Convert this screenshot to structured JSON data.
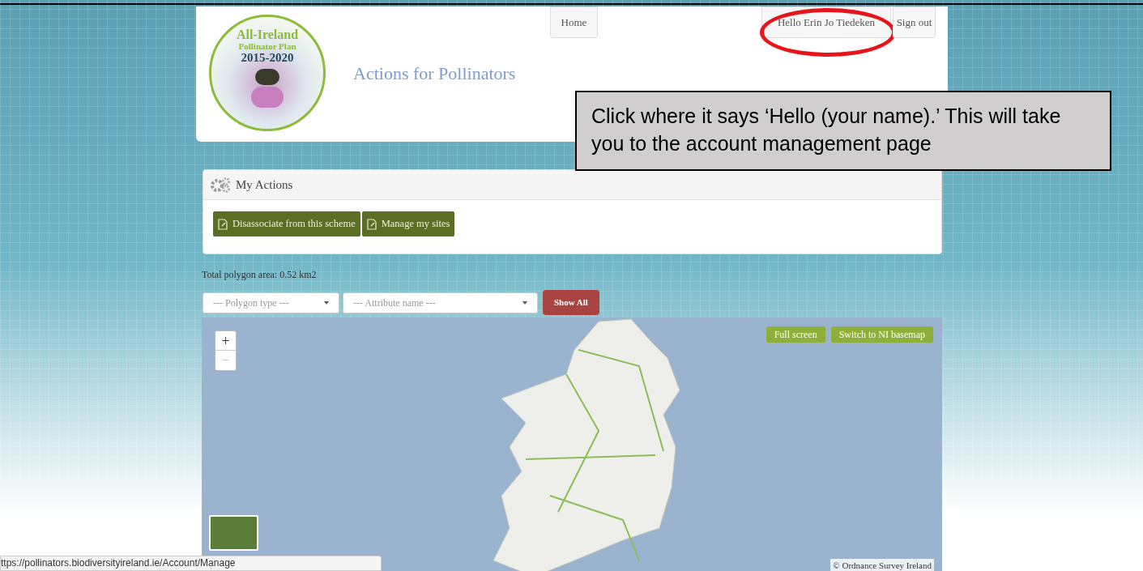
{
  "logo": {
    "line_1": "All-Ireland",
    "line_2": "Pollinator Plan",
    "line_3": "2015-2020"
  },
  "site_title": "Actions for Pollinators",
  "nav": [
    {
      "label": "Home"
    },
    {
      "label": "Hello Erin Jo Tiedeken",
      "highlighted": true
    },
    {
      "label": "Sign out"
    }
  ],
  "callout": {
    "text": "Click where it says ‘Hello (your name).’ This will take you to the account management page"
  },
  "actions_panel": {
    "title": "My Actions",
    "buttons": [
      "Disassociate from this scheme",
      "Manage my sites"
    ]
  },
  "total_area": "Total polygon area: 0.52 km2",
  "filters": [
    {
      "placeholder": "--- Polygon type ---"
    },
    {
      "placeholder": "--- Attribute name ---"
    }
  ],
  "show_all_button": "Show All",
  "map": {
    "zoom_in": "+",
    "zoom_out": "−",
    "buttons": [
      "Full screen",
      "Switch to NI basemap"
    ],
    "attribution": "© Ordnance Survey Ireland"
  },
  "status_bar": "ttps://pollinators.biodiversityireland.ie/Account/Manage"
}
